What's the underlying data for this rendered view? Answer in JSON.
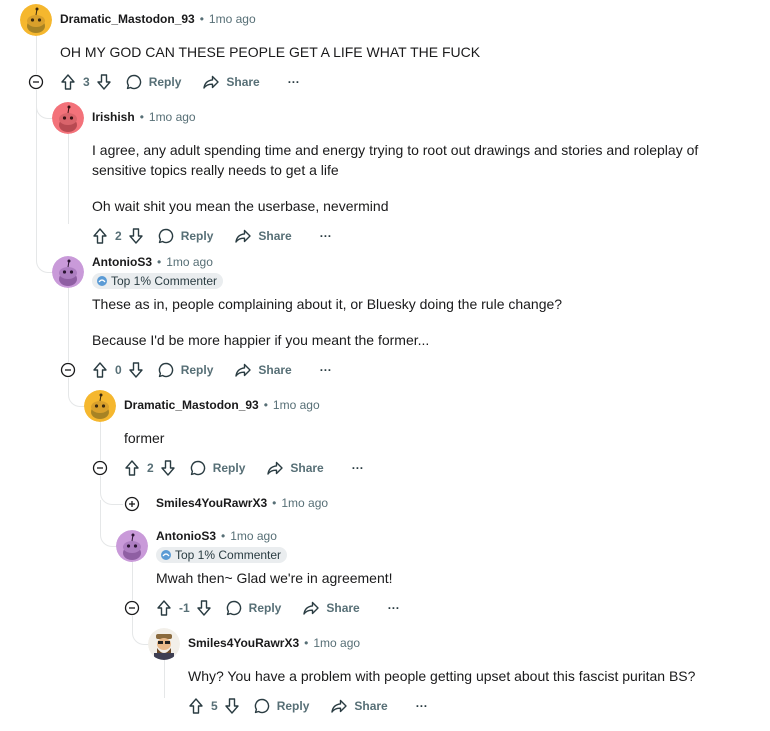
{
  "time": "1mo ago",
  "actions": {
    "reply": "Reply",
    "share": "Share",
    "more": "···"
  },
  "comments": [
    {
      "author": "Dramatic_Mastodon_93",
      "body": [
        "OH MY GOD CAN THESE PEOPLE GET A LIFE WHAT THE FUCK"
      ],
      "score": "3"
    },
    {
      "author": "Irishish",
      "body": [
        "I agree, any adult spending time and energy trying to root out drawings and stories and roleplay of",
        "sensitive topics really needs to get a life",
        "Oh wait shit you mean the userbase, nevermind"
      ],
      "score": "2"
    },
    {
      "author": "AntonioS3",
      "badge": "Top 1% Commenter",
      "body": [
        "These as in, people complaining about it, or Bluesky doing the rule change?",
        "Because I'd be more happier if you meant the former..."
      ],
      "score": "0"
    },
    {
      "author": "Dramatic_Mastodon_93",
      "body": [
        "former"
      ],
      "score": "2"
    },
    {
      "author": "Smiles4YouRawrX3",
      "collapsed": true
    },
    {
      "author": "AntonioS3",
      "badge": "Top 1% Commenter",
      "body": [
        "Mwah then~ Glad we're in agreement!"
      ],
      "score": "-1"
    },
    {
      "author": "Smiles4YouRawrX3",
      "body": [
        "Why? You have a problem with people getting upset about this fascist puritan BS?"
      ],
      "score": "5"
    }
  ],
  "colors": {
    "text": "#1a1a1b",
    "meta": "#576f76",
    "thread": "#e5e7e8",
    "badge_bg": "#eaedef",
    "avatar_yellow": "#f5b72e",
    "avatar_red": "#f3727a",
    "avatar_purple": "#c99ad9"
  }
}
